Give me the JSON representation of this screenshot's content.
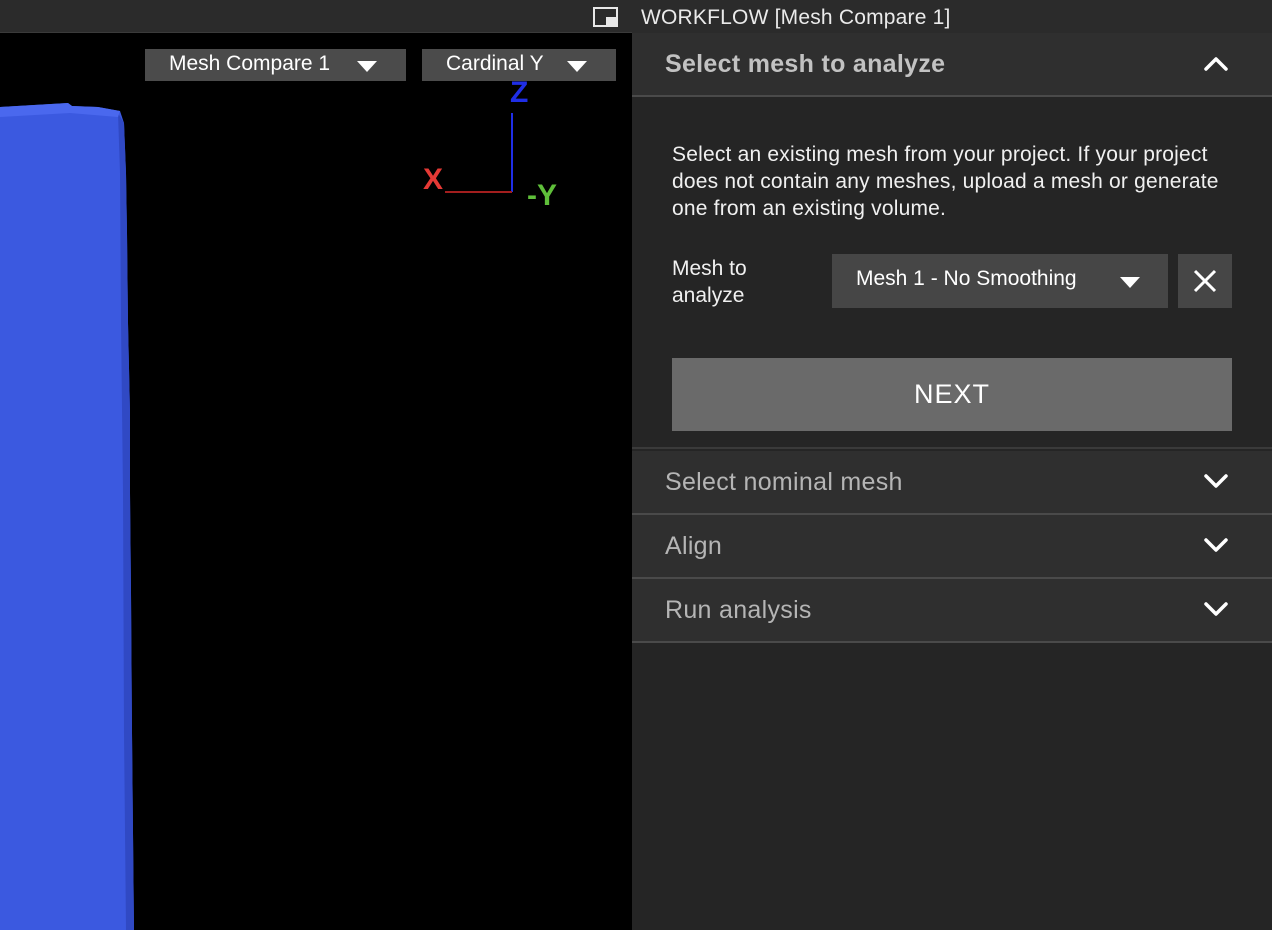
{
  "workflow": {
    "title": "WORKFLOW [Mesh Compare 1]"
  },
  "viewport": {
    "scene_dropdown": "Mesh Compare 1",
    "view_dropdown": "Cardinal Y",
    "axes": {
      "z": "Z",
      "x": "X",
      "y": "-Y"
    },
    "colors": {
      "mesh": "#3b59e0",
      "axis_x": "#e53935",
      "axis_y": "#5fbf3a",
      "axis_z": "#1f2ee6"
    }
  },
  "panel": {
    "sections": [
      {
        "title": "Select mesh to analyze",
        "expanded": true
      },
      {
        "title": "Select nominal mesh",
        "expanded": false
      },
      {
        "title": "Align",
        "expanded": false
      },
      {
        "title": "Run analysis",
        "expanded": false
      }
    ],
    "select_mesh": {
      "description": "Select an existing mesh from your project. If your project does not contain any meshes, upload a mesh or generate one from an existing volume.",
      "field_label": "Mesh to analyze",
      "selected_mesh": "Mesh 1 - No Smoothing",
      "next_label": "NEXT"
    }
  }
}
